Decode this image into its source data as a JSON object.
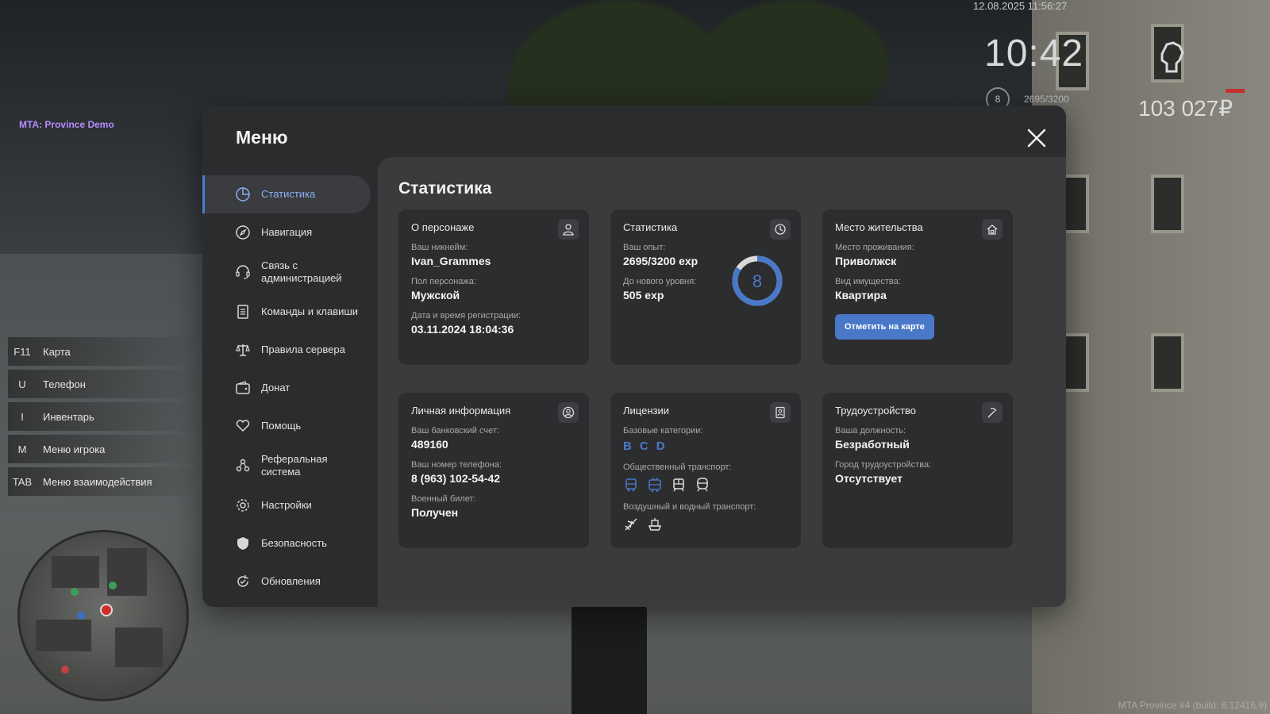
{
  "hud": {
    "server_title": "MTA: Province Demo",
    "datetime": "12.08.2025 11:56:27",
    "clock": "10:42",
    "level": "8",
    "exp": "2695/3200",
    "money": "103 027₽",
    "build": "MTA Province #4 (build: 6.12416.9)"
  },
  "hotkeys": [
    {
      "key": "F11",
      "label": "Карта"
    },
    {
      "key": "U",
      "label": "Телефон"
    },
    {
      "key": "I",
      "label": "Инвентарь"
    },
    {
      "key": "M",
      "label": "Меню игрока"
    },
    {
      "key": "TAB",
      "label": "Меню взаимодействия"
    }
  ],
  "menu": {
    "title": "Меню",
    "nav": [
      {
        "label": "Статистика",
        "icon": "pie-chart-icon"
      },
      {
        "label": "Навигация",
        "icon": "compass-icon"
      },
      {
        "label": "Связь с администрацией",
        "icon": "headset-icon"
      },
      {
        "label": "Команды и клавиши",
        "icon": "document-icon"
      },
      {
        "label": "Правила сервера",
        "icon": "scales-icon"
      },
      {
        "label": "Донат",
        "icon": "wallet-icon"
      },
      {
        "label": "Помощь",
        "icon": "heart-hand-icon"
      },
      {
        "label": "Реферальная система",
        "icon": "users-icon"
      },
      {
        "label": "Настройки",
        "icon": "gear-icon"
      },
      {
        "label": "Безопасность",
        "icon": "shield-icon"
      },
      {
        "label": "Обновления",
        "icon": "refresh-icon"
      }
    ],
    "active": "Статистика"
  },
  "content": {
    "title": "Статистика",
    "character": {
      "title": "О персонаже",
      "nick_label": "Ваш никнейм:",
      "nick": "Ivan_Grammes",
      "gender_label": "Пол персонажа:",
      "gender": "Мужской",
      "reg_label": "Дата и время регистрации:",
      "reg": "03.11.2024 18:04:36"
    },
    "stats": {
      "title": "Статистика",
      "exp_label": "Ваш опыт:",
      "exp": "2695/3200 exp",
      "next_label": "До нового уровня:",
      "next": "505 exp",
      "level": "8",
      "progress": 0.842
    },
    "residence": {
      "title": "Место жительства",
      "place_label": "Место проживания:",
      "place": "Приволжск",
      "type_label": "Вид имущества:",
      "type": "Квартира",
      "button": "Отметить на карте"
    },
    "personal": {
      "title": "Личная информация",
      "bank_label": "Ваш банковский счет:",
      "bank": "489160",
      "phone_label": "Ваш номер телефона:",
      "phone": "8 (963) 102-54-42",
      "military_label": "Военный билет:",
      "military": "Получен"
    },
    "licenses": {
      "title": "Лицензии",
      "base_label": "Базовые категории:",
      "base": [
        "B",
        "C",
        "D"
      ],
      "public_label": "Общественный транспорт:",
      "air_label": "Воздушный и водный транспорт:"
    },
    "employment": {
      "title": "Трудоустройство",
      "position_label": "Ваша должность:",
      "position": "Безработный",
      "city_label": "Город трудоустройства:",
      "city": "Отсутствует"
    }
  },
  "colors": {
    "accent": "#4a78c8",
    "panel": "#2b2c2e",
    "content_bg": "#3a3b3d",
    "card_bg": "#2c2d2f",
    "server_title": "#b68cff"
  }
}
